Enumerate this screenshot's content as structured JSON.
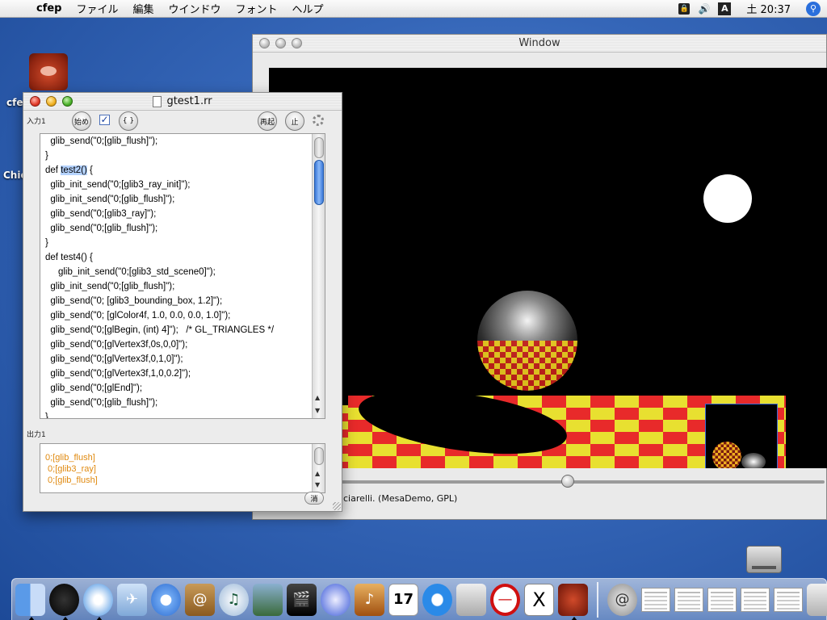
{
  "menubar": {
    "app_name": "cfep",
    "items": [
      "ファイル",
      "編集",
      "ウインドウ",
      "フォント",
      "ヘルプ"
    ],
    "clock": "土 20:37",
    "input_menu_glyph": "A"
  },
  "desktop": {
    "icon_label": "cfe",
    "second_label": "Chic"
  },
  "gl_window": {
    "title": "Window",
    "credit": "ciarelli. (MesaDemo, GPL)",
    "slider_level": 0.47
  },
  "editor": {
    "title": "gtest1.rr",
    "input_label": "入力1",
    "output_label": "出力1",
    "buttons": {
      "start": "始め",
      "braces": "{ }",
      "restart": "再起",
      "stop": "止",
      "clear": "消"
    },
    "checkbox_checked": true,
    "code_lines": [
      "  glib_send(\"0;[glib_flush]\");",
      "}",
      "def test2() {",
      "  glib_init_send(\"0;[glib3_ray_init]\");",
      "  glib_init_send(\"0;[glib_flush]\");",
      "  glib_send(\"0;[glib3_ray]\");",
      "  glib_send(\"0;[glib_flush]\");",
      "}",
      "def test4() {",
      "     glib_init_send(\"0;[glib3_std_scene0]\");",
      "  glib_init_send(\"0;[glib_flush]\");",
      "  glib_send(\"0; [glib3_bounding_box, 1.2]\");",
      "  glib_send(\"0; [glColor4f, 1.0, 0.0, 0.0, 1.0]\");",
      "  glib_send(\"0;[glBegin, (int) 4]\");   /* GL_TRIANGLES */",
      "  glib_send(\"0;[glVertex3f,0s,0,0]\");",
      "  glib_send(\"0;[glVertex3f,0,1,0]\");",
      "  glib_send(\"0;[glVertex3f,1,0,0.2]\");",
      "  glib_send(\"0;[glEnd]\");",
      "  glib_send(\"0;[glib_flush]\");",
      "}"
    ],
    "selected_text": "test2()",
    "output_lines": [
      "0;[glib_flush]",
      " 0;[glib3_ray]",
      " 0;[glib_flush]"
    ]
  },
  "dock": {
    "items": [
      "finder",
      "dashboard",
      "safari",
      "mail",
      "ichat",
      "address-book",
      "itunes",
      "iphoto",
      "imovie",
      "idvd",
      "garageband",
      "ical",
      "quicktime",
      "system-preferences",
      "no-entry",
      "x11",
      "cfep"
    ],
    "ical_date": "17",
    "x11_glyph": "X"
  },
  "colors": {
    "code_selection": "#b5d3ff",
    "output_text": "#e08a10",
    "floor_yellow": "#e8e030",
    "floor_red": "#e82a2a"
  }
}
